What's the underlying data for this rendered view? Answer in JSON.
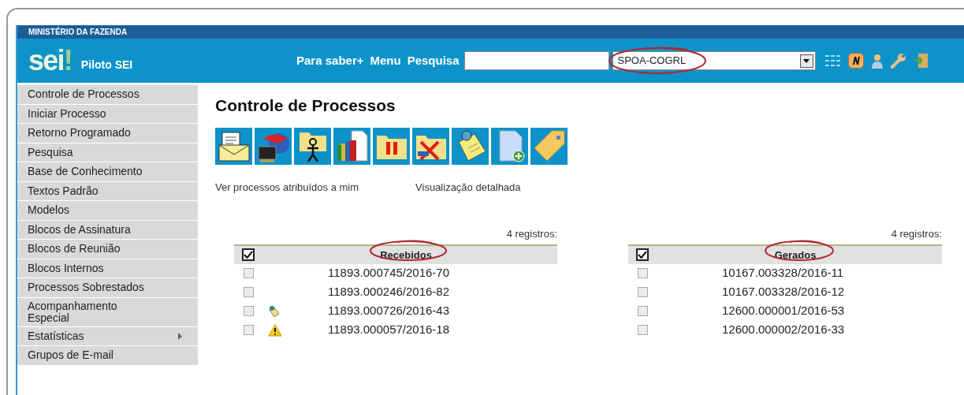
{
  "header": {
    "ministry": "MINISTÉRIO DA FAZENDA",
    "logo": "sei",
    "logo_mark": "!",
    "system": "Piloto SEI",
    "links": [
      "Para saber+",
      "Menu",
      "Pesquisa"
    ],
    "unit_select": {
      "value": "SPOA-COGRL",
      "circled": true
    }
  },
  "sidebar": {
    "items": [
      {
        "label": "Controle de Processos",
        "has_submenu": false
      },
      {
        "label": "Iniciar Processo",
        "has_submenu": false
      },
      {
        "label": "Retorno Programado",
        "has_submenu": false
      },
      {
        "label": "Pesquisa",
        "has_submenu": false
      },
      {
        "label": "Base de Conhecimento",
        "has_submenu": false
      },
      {
        "label": "Textos Padrão",
        "has_submenu": false
      },
      {
        "label": "Modelos",
        "has_submenu": false
      },
      {
        "label": "Blocos de Assinatura",
        "has_submenu": false
      },
      {
        "label": "Blocos de Reunião",
        "has_submenu": false
      },
      {
        "label": "Blocos Internos",
        "has_submenu": false
      },
      {
        "label": "Processos Sobrestados",
        "has_submenu": false
      },
      {
        "label": "Acompanhamento Especial",
        "has_submenu": false
      },
      {
        "label": "Estatísticas",
        "has_submenu": true
      },
      {
        "label": "Grupos de E-mail",
        "has_submenu": false
      }
    ]
  },
  "page": {
    "title": "Controle de Processos",
    "links": [
      "Ver processos atribuídos a mim",
      "Visualização detalhada"
    ]
  },
  "tables": [
    {
      "count": "4 registros:",
      "header": {
        "label": "Recebidos",
        "checked": true,
        "circled": true
      },
      "rows": [
        {
          "kind": "plain",
          "number": "11893.000745/2016-70",
          "checked": false
        },
        {
          "kind": "plain",
          "number": "11893.000246/2016-82",
          "checked": false
        },
        {
          "kind": "note",
          "number": "11893.000726/2016-43",
          "checked": false
        },
        {
          "kind": "warning",
          "number": "11893.000057/2016-18",
          "checked": false
        }
      ]
    },
    {
      "count": "4 registros:",
      "header": {
        "label": "Gerados",
        "checked": true,
        "circled": true
      },
      "rows": [
        {
          "kind": "plain",
          "number": "10167.003328/2016-11",
          "checked": false
        },
        {
          "kind": "plain",
          "number": "10167.003328/2016-12",
          "checked": false
        },
        {
          "kind": "plain",
          "number": "12600.000001/2016-53",
          "checked": false
        },
        {
          "kind": "plain",
          "number": "12600.000002/2016-33",
          "checked": false
        }
      ]
    }
  ]
}
